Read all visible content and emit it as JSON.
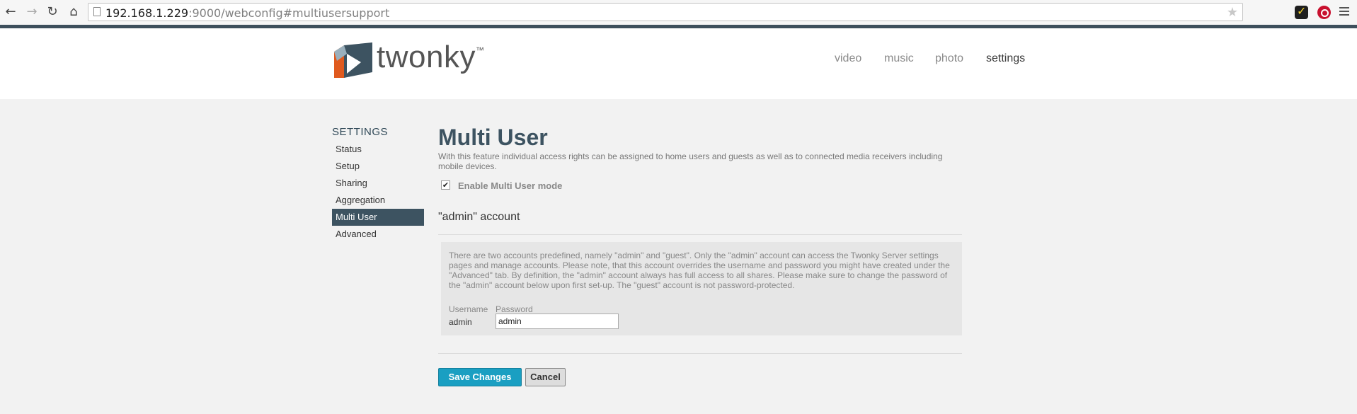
{
  "browser": {
    "url_host": "192.168.1.229",
    "url_rest": ":9000/webconfig#multiusersupport",
    "icons": [
      "back-icon",
      "forward-icon",
      "reload-icon",
      "home-icon",
      "star-icon",
      "menu-icon"
    ]
  },
  "header": {
    "logo_text": "twonky",
    "logo_tm": "™",
    "nav": [
      {
        "label": "video"
      },
      {
        "label": "music"
      },
      {
        "label": "photo"
      },
      {
        "label": "settings",
        "active": true
      }
    ]
  },
  "sidebar": {
    "title": "SETTINGS",
    "items": [
      {
        "label": "Status"
      },
      {
        "label": "Setup"
      },
      {
        "label": "Sharing"
      },
      {
        "label": "Aggregation"
      },
      {
        "label": "Multi User",
        "active": true
      },
      {
        "label": "Advanced"
      }
    ]
  },
  "main": {
    "title": "Multi User",
    "description": "With this feature individual access rights can be assigned to home users and guests as well as to connected media receivers including mobile devices.",
    "enable_label": "Enable Multi User mode",
    "enable_checked": true,
    "section_title": "\"admin\" account",
    "info": "There are two accounts predefined, namely \"admin\" and \"guest\". Only the \"admin\" account can access the Twonky Server settings pages and manage accounts. Please note, that this account overrides the username and password you might have created under the \"Advanced\" tab. By definition, the \"admin\" account always has full access to all shares. Please make sure to change the password of the \"admin\" account below upon first set-up. The \"guest\" account is not password-protected.",
    "username_label": "Username",
    "password_label": "Password",
    "username_value": "admin",
    "password_value": "admin",
    "save_label": "Save Changes",
    "cancel_label": "Cancel"
  },
  "colors": {
    "accent": "#1a9fc2",
    "sidebar_active": "#3d5361",
    "title": "#3d5361"
  }
}
